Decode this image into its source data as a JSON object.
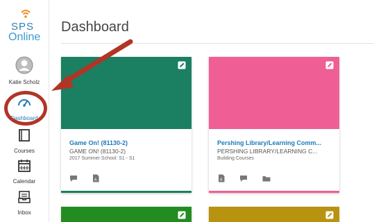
{
  "nav": {
    "logo_top": "SPS",
    "logo_bottom": "Online",
    "user": "Katie Scholz",
    "items": [
      {
        "label": "Dashboard"
      },
      {
        "label": "Courses"
      },
      {
        "label": "Calendar"
      },
      {
        "label": "Inbox"
      }
    ]
  },
  "header": {
    "title": "Dashboard"
  },
  "colors": {
    "accent_blue": "#1f7ab8",
    "card1": "#1b7f62",
    "card2": "#ef5f95",
    "card3": "#228c21",
    "card4": "#b8930f",
    "highlight": "#b13526"
  },
  "cards": [
    {
      "title": "Game On! (81130-2)",
      "subtitle": "GAME ON! (81130-2)",
      "term": "2017 Summer School: S1 - S1"
    },
    {
      "title": "Pershing Library/Learning Comm...",
      "subtitle": "PERSHING LIBRARY/LEARNING C...",
      "term": "Building Courses"
    }
  ]
}
